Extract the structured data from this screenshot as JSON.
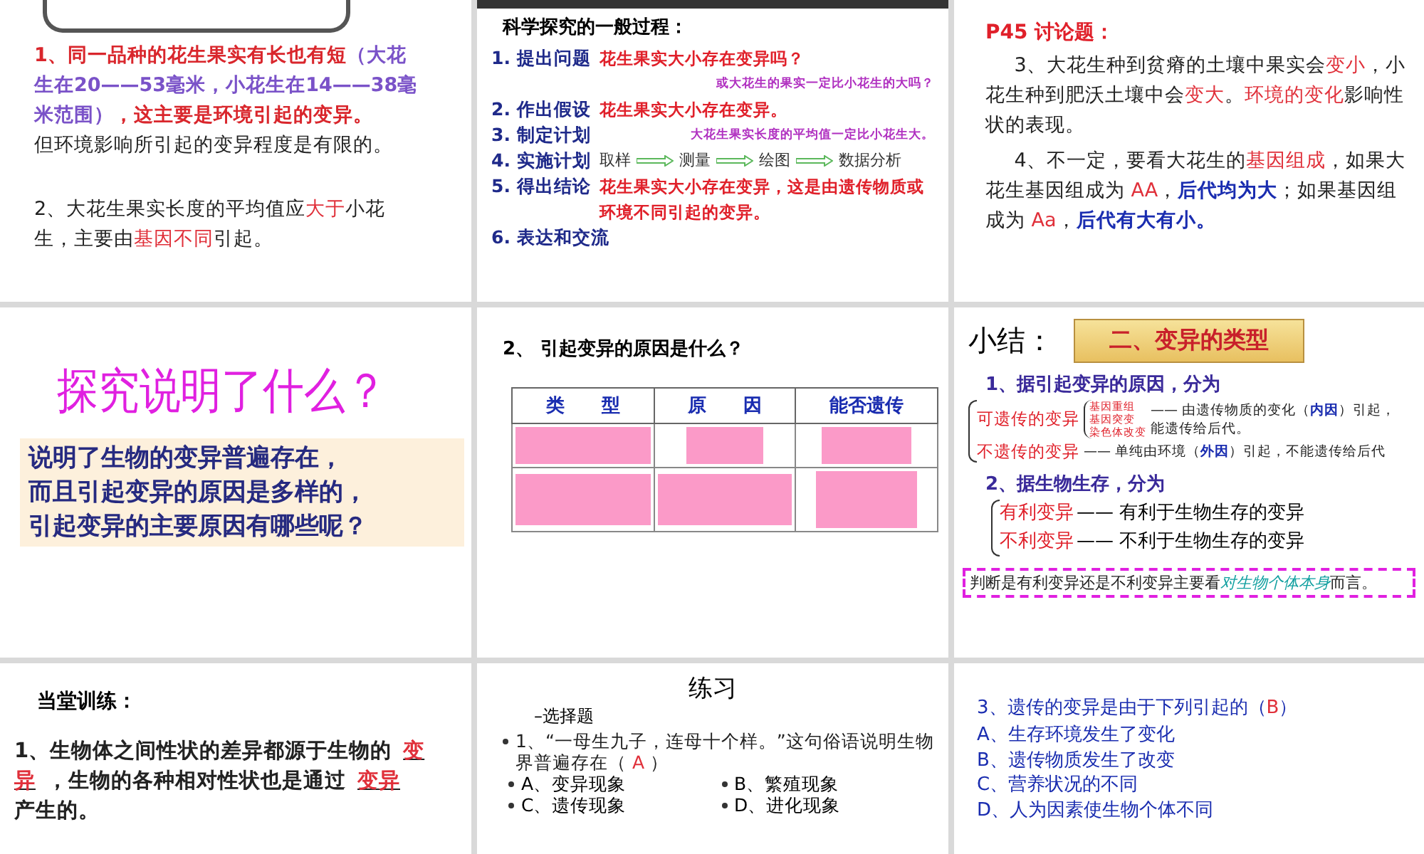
{
  "slides": [
    {
      "kind": "notes",
      "paragraphs": [
        [
          {
            "text": "1、同一品种的花生果实有长也有短",
            "kind": "red"
          },
          {
            "text": "（大花生在20——53毫米，小花生在14——38毫米范围）",
            "kind": "purple"
          },
          {
            "text": "，这主要是环境引起的变异。",
            "kind": "red"
          },
          {
            "text": "但环境影响所引起的变异程度是有限的。",
            "kind": "plainblock"
          }
        ],
        [
          {
            "text": "2、大花生果实长度的平均值应",
            "kind": "plain"
          },
          {
            "text": "大于",
            "kind": "accent"
          },
          {
            "text": "小花生，主要由",
            "kind": "plain"
          },
          {
            "text": "基因不同",
            "kind": "accent"
          },
          {
            "text": "引起。",
            "kind": "plain"
          }
        ]
      ]
    },
    {
      "kind": "process",
      "title": "科学探究的一般过程：",
      "steps": [
        {
          "label": "1. 提出问题",
          "note": "花生果实大小存在变异吗？",
          "subnote": "或大花生的果实一定比小花生的大吗？"
        },
        {
          "label": "2. 作出假设",
          "note": "花生果实大小存在变异。"
        },
        {
          "label": "3. 制定计划",
          "subnote": "大花生果实长度的平均值一定比小花生大。"
        },
        {
          "label": "4. 实施计划",
          "flow": [
            "取样",
            "测量",
            "绘图",
            "数据分析"
          ]
        },
        {
          "label": "5. 得出结论",
          "note": "花生果实大小存在变异，这是由遗传物质或环境不同引起的变异。"
        },
        {
          "label": "6. 表达和交流"
        }
      ]
    },
    {
      "kind": "discussion",
      "title": "P45 讨论题：",
      "paragraphs": [
        [
          {
            "text": "3、大花生种到贫瘠的土壤中果实会",
            "kind": "plain"
          },
          {
            "text": "变小",
            "kind": "accent"
          },
          {
            "text": "，小花生种到肥沃土壤中会",
            "kind": "plain"
          },
          {
            "text": "变大",
            "kind": "accent"
          },
          {
            "text": "。",
            "kind": "plain"
          },
          {
            "text": "环境的变化",
            "kind": "accent"
          },
          {
            "text": "影响性状的表现。",
            "kind": "plain"
          }
        ],
        [
          {
            "text": "4、不一定，要看大花生的",
            "kind": "plain"
          },
          {
            "text": "基因组成",
            "kind": "accent"
          },
          {
            "text": "，如果大花生基因组成为 ",
            "kind": "plain"
          },
          {
            "text": "AA",
            "kind": "accent"
          },
          {
            "text": "，",
            "kind": "plain"
          },
          {
            "text": "后代均为大",
            "kind": "blue"
          },
          {
            "text": "；如果基因组成为 ",
            "kind": "plain"
          },
          {
            "text": "Aa",
            "kind": "accent"
          },
          {
            "text": "，",
            "kind": "plain"
          },
          {
            "text": "后代有大有小。",
            "kind": "blue"
          }
        ]
      ]
    },
    {
      "kind": "question",
      "title": "探究说明了什么？",
      "lines": [
        "说明了生物的变异普遍存在，",
        "而且引起变异的原因是多样的，",
        "引起变异的主要原因有哪些呢？"
      ]
    },
    {
      "kind": "table",
      "title": "2、 引起变异的原因是什么？",
      "columns": [
        "类　　型",
        "原　　因",
        "能否遗传"
      ]
    },
    {
      "kind": "summary",
      "title": "小结：",
      "banner": "二、变异的类型",
      "heading1": "1、据引起变异的原因，分为",
      "heritable": {
        "label": "可遗传的变异",
        "subtypes": [
          "基因重组",
          "基因突变",
          "染色体改变"
        ],
        "note": [
          {
            "text": "—— 由遗传物质的变化（",
            "kind": "plain"
          },
          {
            "text": "内因",
            "kind": "blue"
          },
          {
            "text": "）引起，能遗传给后代。",
            "kind": "plain"
          }
        ]
      },
      "nonheritable": {
        "label": "不遗传的变异",
        "note": [
          {
            "text": "—— 单纯由环境（",
            "kind": "plain"
          },
          {
            "text": "外因",
            "kind": "blue"
          },
          {
            "text": "）引起，不能遗传给后代",
            "kind": "plain"
          }
        ]
      },
      "heading2": "2、据生物生存，分为",
      "survival": [
        {
          "label": "有利变异",
          "note": "—— 有利于生物生存的变异"
        },
        {
          "label": "不利变异",
          "note": "—— 不利于生物生存的变异"
        }
      ],
      "conclusion": [
        {
          "text": "判断是有利变异还是不利变异主要看",
          "kind": "plain"
        },
        {
          "text": "对生物个体本身",
          "kind": "teal"
        },
        {
          "text": "而言。",
          "kind": "plain"
        }
      ]
    },
    {
      "kind": "fillin",
      "title": "当堂训练：",
      "paragraph": [
        {
          "text": "1、生物体之间性状的差异都源于生物的",
          "kind": "plain"
        },
        {
          "text": "变异",
          "kind": "blank"
        },
        {
          "text": "，生物的各种相对性状也是通过",
          "kind": "plain"
        },
        {
          "text": "变异",
          "kind": "blank"
        },
        {
          "text": "产生的。",
          "kind": "plain"
        }
      ]
    },
    {
      "kind": "choice",
      "title": "练习",
      "subtitle": "–选择题",
      "question": [
        {
          "text": "1、“一母生九子，连母十个样。”这句俗语说明生物界普遍存在（ ",
          "kind": "plain"
        },
        {
          "text": "A",
          "kind": "accent"
        },
        {
          "text": " ）",
          "kind": "plain"
        }
      ],
      "options": [
        "A、变异现象",
        "B、繁殖现象",
        "C、遗传现象",
        "D、进化现象"
      ]
    },
    {
      "kind": "choice2",
      "question": [
        {
          "text": "3、遗传的变异是由于下列引起的（",
          "kind": "plain"
        },
        {
          "text": "B",
          "kind": "accent"
        },
        {
          "text": "）",
          "kind": "plain"
        }
      ],
      "options": [
        "A、生存环境发生了变化",
        "B、遗传物质发生了改变",
        "C、营养状况的不同",
        "D、人为因素使生物个体不同"
      ]
    }
  ]
}
